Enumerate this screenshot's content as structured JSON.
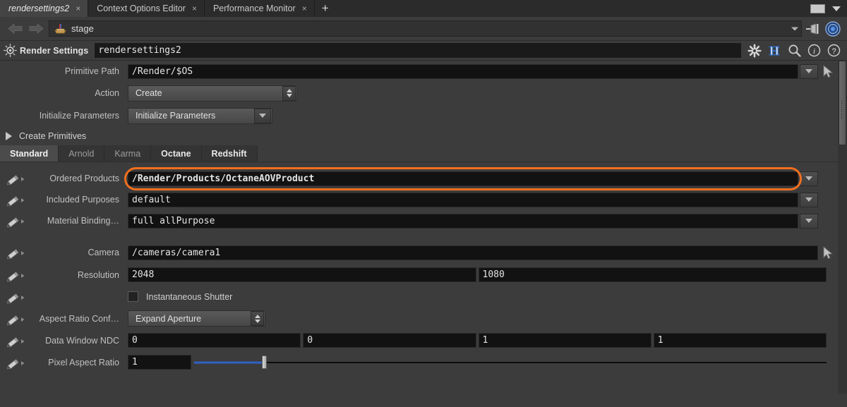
{
  "tabbar": {
    "tabs": [
      {
        "label": "rendersettings2",
        "close": "×",
        "active": true
      },
      {
        "label": "Context Options Editor",
        "close": "×",
        "active": false
      },
      {
        "label": "Performance Monitor",
        "close": "×",
        "active": false
      }
    ],
    "add_label": "+"
  },
  "pathbar": {
    "back_icon": "back-arrow-icon",
    "forward_icon": "forward-arrow-icon",
    "path": "stage",
    "stage_icon": "stage-icon",
    "pin_icon": "pin-icon",
    "target_icon": "target-icon"
  },
  "node_header": {
    "type_icon": "render-settings-icon",
    "title": "Render Settings",
    "name": "rendersettings2",
    "tools": [
      {
        "name": "gear-icon",
        "glyph": "✻"
      },
      {
        "name": "houdini-h-icon",
        "glyph": "H"
      },
      {
        "name": "search-icon",
        "glyph": "⚲"
      },
      {
        "name": "info-icon",
        "glyph": "i"
      },
      {
        "name": "help-icon",
        "glyph": "?"
      }
    ]
  },
  "parameters": {
    "primitive_path": {
      "label": "Primitive Path",
      "value": "/Render/$OS"
    },
    "action": {
      "label": "Action",
      "value": "Create"
    },
    "initialize_parameters": {
      "label": "Initialize Parameters",
      "value": "Initialize Parameters"
    },
    "create_primitives_section": {
      "label": "Create Primitives",
      "expanded": false
    },
    "render_tabs": [
      {
        "label": "Standard",
        "active": true,
        "strong": true
      },
      {
        "label": "Arnold",
        "active": false,
        "strong": false
      },
      {
        "label": "Karma",
        "active": false,
        "strong": false
      },
      {
        "label": "Octane",
        "active": false,
        "strong": true
      },
      {
        "label": "Redshift",
        "active": false,
        "strong": true
      }
    ],
    "ordered_products": {
      "label": "Ordered Products",
      "value": "/Render/Products/OctaneAOVProduct",
      "highlighted": true,
      "highlight_color": "#f36f1e"
    },
    "included_purposes": {
      "label": "Included Purposes",
      "value": "default"
    },
    "material_binding": {
      "label": "Material Binding…",
      "value": "full allPurpose"
    },
    "camera": {
      "label": "Camera",
      "value": "/cameras/camera1"
    },
    "resolution": {
      "label": "Resolution",
      "values": [
        "2048",
        "1080"
      ]
    },
    "instantaneous_shutter": {
      "label": "Instantaneous Shutter",
      "checked": false
    },
    "aspect_ratio_conform": {
      "label": "Aspect Ratio Conf…",
      "value": "Expand Aperture"
    },
    "data_window_ndc": {
      "label": "Data Window NDC",
      "values": [
        "0",
        "0",
        "1",
        "1"
      ]
    },
    "pixel_aspect_ratio": {
      "label": "Pixel Aspect Ratio",
      "value": "1",
      "slider_percent": 11
    }
  }
}
